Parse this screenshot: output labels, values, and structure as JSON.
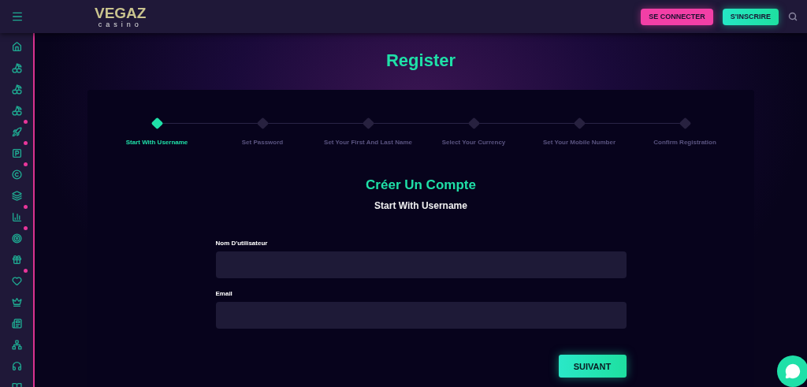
{
  "header": {
    "logo": "VEGAZ",
    "logo_sub": "casino",
    "buttons": [
      {
        "label": "SE CONNECTER",
        "kind": "pink"
      },
      {
        "label": "S'INSCRIRE",
        "kind": "green"
      }
    ]
  },
  "sidebar": {
    "items": [
      {
        "kind": "home",
        "dot": false
      },
      {
        "kind": "slot",
        "dot": false
      },
      {
        "kind": "slot",
        "dot": false
      },
      {
        "kind": "slot",
        "dot": false
      },
      {
        "kind": "rocket",
        "dot": true
      },
      {
        "kind": "parking",
        "dot": true
      },
      {
        "kind": "copyright",
        "dot": true
      },
      {
        "kind": "cards",
        "dot": false
      },
      {
        "kind": "chart",
        "dot": true
      },
      {
        "kind": "target",
        "dot": true
      },
      {
        "kind": "gift",
        "dot": false
      },
      {
        "kind": "heart",
        "dot": true
      },
      {
        "kind": "crown",
        "dot": false
      },
      {
        "kind": "news",
        "dot": false
      },
      {
        "kind": "network",
        "dot": false
      },
      {
        "kind": "headset",
        "dot": false
      },
      {
        "kind": "book",
        "dot": false
      }
    ]
  },
  "page_title": "Register",
  "steps": [
    {
      "label": "Start With Username",
      "selected": true
    },
    {
      "label": "Set Password",
      "selected": false
    },
    {
      "label": "Set Your First And Last Name",
      "selected": false
    },
    {
      "label": "Select Your Currency",
      "selected": false
    },
    {
      "label": "Set Your Mobile Number",
      "selected": false
    },
    {
      "label": "Confirm Registration",
      "selected": false
    }
  ],
  "form": {
    "title": "Créer Un Compte",
    "subtitle": "Start With Username",
    "fields": [
      {
        "label": "Nom D'utilisateur"
      },
      {
        "label": "Email"
      }
    ],
    "submit": "SUIVANT"
  }
}
